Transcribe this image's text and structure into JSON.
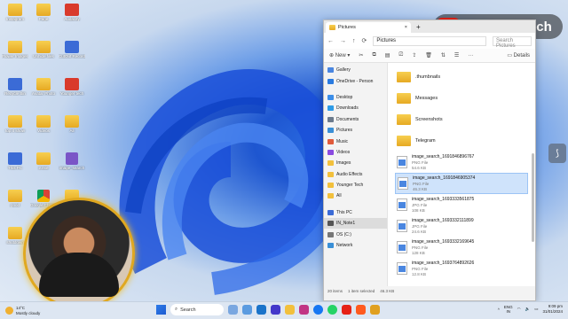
{
  "colors": {
    "accent": "#1e56d0",
    "folder": "#f2c03c",
    "brand_red": "#e62117",
    "selection": "#cfe3fb"
  },
  "brand": {
    "text": "Younger Tech",
    "icon": "youtube-play-icon"
  },
  "desktop_icons": [
    {
      "label": "Instagram",
      "icon": "folder-icon"
    },
    {
      "label": "Page",
      "icon": "folder-icon"
    },
    {
      "label": "Audacity",
      "icon": "audacity-icon"
    },
    {
      "label": "Flower Images",
      "icon": "folder-icon"
    },
    {
      "label": "Unhide files",
      "icon": "folder-icon"
    },
    {
      "label": "CutOut Recorder",
      "icon": "app-icon"
    },
    {
      "label": "Recycle Bin",
      "icon": "recycle-bin-icon"
    },
    {
      "label": "Avatar Photo",
      "icon": "folder-icon"
    },
    {
      "label": "Younger tech",
      "icon": "home-icon"
    },
    {
      "label": "top 4 show",
      "icon": "folder-icon"
    },
    {
      "label": "Videos",
      "icon": "folder-icon"
    },
    {
      "label": "All",
      "icon": "folder-icon"
    },
    {
      "label": "This PC",
      "icon": "pc-icon"
    },
    {
      "label": "2.exe",
      "icon": "folder-icon"
    },
    {
      "label": "image_search",
      "icon": "powerpoint-icon"
    },
    {
      "label": "good",
      "icon": "folder-icon"
    },
    {
      "label": "Google Chrome",
      "icon": "chrome-icon"
    },
    {
      "label": "external",
      "icon": "folder-icon"
    },
    {
      "label": "shutdown",
      "icon": "folder-icon"
    }
  ],
  "explorer": {
    "tab_title": "Pictures",
    "address": "Pictures",
    "search_placeholder": "Search Pictures",
    "toolbar": {
      "new_label": "New",
      "details_label": "Details"
    },
    "nav": [
      {
        "label": "Gallery",
        "icon": "gallery-icon"
      },
      {
        "label": "OneDrive - Person",
        "icon": "cloud-icon"
      },
      {
        "label": "Desktop",
        "icon": "desktop-icon"
      },
      {
        "label": "Downloads",
        "icon": "download-icon"
      },
      {
        "label": "Documents",
        "icon": "document-icon"
      },
      {
        "label": "Pictures",
        "icon": "pictures-icon"
      },
      {
        "label": "Music",
        "icon": "music-icon"
      },
      {
        "label": "Videos",
        "icon": "video-icon"
      },
      {
        "label": "Images",
        "icon": "folder-icon"
      },
      {
        "label": "Audio Effects",
        "icon": "folder-icon"
      },
      {
        "label": "Younger Tech",
        "icon": "folder-icon"
      },
      {
        "label": "All",
        "icon": "folder-icon"
      },
      {
        "label": "This PC",
        "icon": "pc-icon"
      },
      {
        "label": "IN_Note1",
        "icon": "phone-icon"
      },
      {
        "label": "OS (C:)",
        "icon": "drive-icon"
      },
      {
        "label": "Network",
        "icon": "network-icon"
      }
    ],
    "folders": [
      ".thumbnails",
      "Messages",
      "Screenshots",
      "Telegram"
    ],
    "files": [
      {
        "name": "image_search_1691846896767",
        "type": "PNG File",
        "size": "54.6 KB"
      },
      {
        "name": "image_search_1691846905374",
        "type": "PNG File",
        "size": "46.3 KB"
      },
      {
        "name": "image_search_1693333561875",
        "type": "JPG File",
        "size": "108 KB"
      },
      {
        "name": "image_search_1693332111899",
        "type": "JPG File",
        "size": "24.6 KB"
      },
      {
        "name": "image_search_1693332169645",
        "type": "PNG File",
        "size": "128 KB"
      },
      {
        "name": "image_search_1693764892626",
        "type": "PNG File",
        "size": "12.8 KB"
      }
    ],
    "status": {
      "count": "20 items",
      "selected": "1 item selected",
      "size": "46.3 KB"
    }
  },
  "taskbar": {
    "weather_temp": "14°C",
    "weather_desc": "Mostly cloudy",
    "search_label": "Search",
    "lang_top": "ENG",
    "lang_bottom": "IN",
    "time": "9:09 pm",
    "date": "31/01/2024"
  }
}
